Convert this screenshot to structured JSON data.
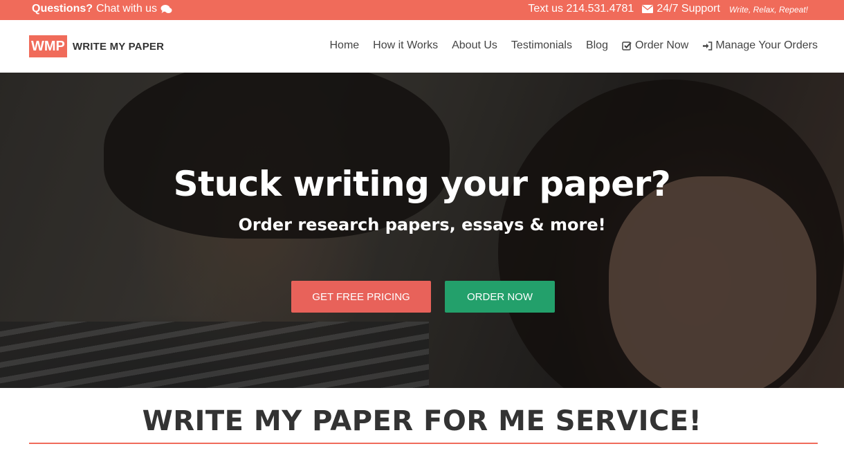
{
  "topbar": {
    "questions_label": "Questions?",
    "chat_label": "Chat with us",
    "phone_label": "Text us 214.531.4781",
    "support_label": "24/7 Support",
    "tagline": "Write, Relax, Repeat!",
    "icons": [
      "chat-icon",
      "envelope-icon"
    ]
  },
  "header": {
    "logo_badge": "WMP",
    "logo_name": "WRITE MY PAPER",
    "nav": [
      {
        "label": "Home"
      },
      {
        "label": "How it Works"
      },
      {
        "label": "About Us"
      },
      {
        "label": "Testimonials"
      },
      {
        "label": "Blog"
      },
      {
        "label": "Order Now",
        "icon": "checkbox-icon"
      },
      {
        "label": "Manage Your Orders",
        "icon": "sign-in-icon"
      }
    ]
  },
  "hero": {
    "title": "Stuck writing your paper?",
    "subtitle": "Order research papers, essays & more!",
    "pricing_button": "GET FREE PRICING",
    "order_button": "ORDER NOW"
  },
  "section": {
    "title": "WRITE MY PAPER FOR ME SERVICE!"
  },
  "colors": {
    "brand": "#f06b5a",
    "pricing_button": "#e8625a",
    "order_button": "#23a06b"
  }
}
